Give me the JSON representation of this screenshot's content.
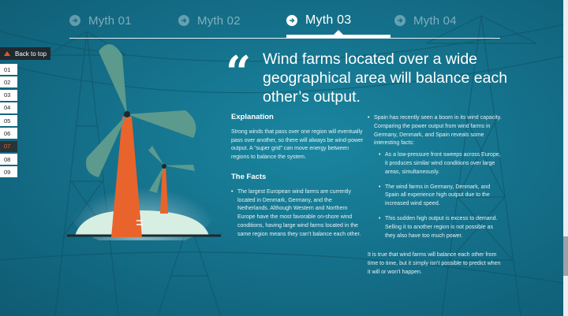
{
  "nav": {
    "tabs": [
      {
        "label": "Myth 01"
      },
      {
        "label": "Myth 02"
      },
      {
        "label": "Myth 03"
      },
      {
        "label": "Myth 04"
      }
    ],
    "active_index": 2
  },
  "sidebar": {
    "back_to_top": "Back to top",
    "pages": [
      "01",
      "02",
      "03",
      "04",
      "05",
      "06",
      "07",
      "08",
      "09"
    ],
    "active_page": "07"
  },
  "quote": {
    "mark": "“",
    "headline": "Wind farms located over a wide geographical area will balance each other’s output."
  },
  "explanation": {
    "heading": "Explanation",
    "text": "Strong winds that pass over one region will eventually pass over another, so there will always be wind-power output. A “super grid” can move energy between regions to balance the system."
  },
  "facts": {
    "heading": "The Facts",
    "bullet1": "The largest European wind farms are currently located in Denmark, Germany, and the Netherlands. Although Western and Northern Europe have the most favorable on-shore wind conditions, having large wind farms located in the same region means they can’t balance each other.",
    "bullet2": "Spain has recently seen a boom in its wind capacity. Comparing the power output from wind farms in Germany, Denmark, and Spain reveals some interesting facts:",
    "sub1": "As a low-pressure front sweeps across Europe, it produces similar wind conditions over large areas, simultaneously.",
    "sub2": "The wind farms in Germany, Denmark, and Spain all experience high output due to the increased wind speed.",
    "sub3": "This sudden high output is excess to demand. Selling it to another region is not possible as they also have too much power.",
    "closing": "It is true that wind farms will balance each other from time to time, but it simply isn’t possible to predict when it will or won’t happen."
  },
  "colors": {
    "background": "#16708a",
    "accent_orange": "#e8642c",
    "turbine_blade": "#5c9a8e"
  }
}
